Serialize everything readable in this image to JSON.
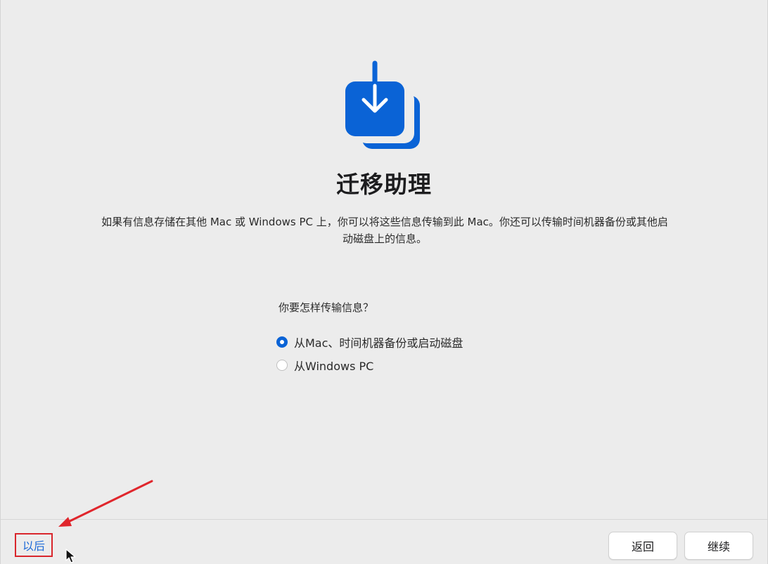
{
  "header": {
    "title": "迁移助理",
    "description": "如果有信息存储在其他 Mac 或 Windows PC 上，你可以将这些信息传输到此 Mac。你还可以传输时间机器备份或其他启动磁盘上的信息。"
  },
  "form": {
    "question": "你要怎样传输信息？",
    "options": [
      {
        "label": "从Mac、时间机器备份或启动磁盘",
        "selected": true
      },
      {
        "label": "从Windows PC",
        "selected": false
      }
    ]
  },
  "footer": {
    "later_label": "以后",
    "back_label": "返回",
    "continue_label": "继续"
  },
  "icons": {
    "app": "migration-assistant-icon",
    "cursor": "pointer-cursor-icon",
    "annotation": "red-arrow-annotation"
  },
  "colors": {
    "accent": "#0a63d6",
    "link": "#1e6ad8",
    "annotation": "#d9262c",
    "background": "#ececec"
  }
}
